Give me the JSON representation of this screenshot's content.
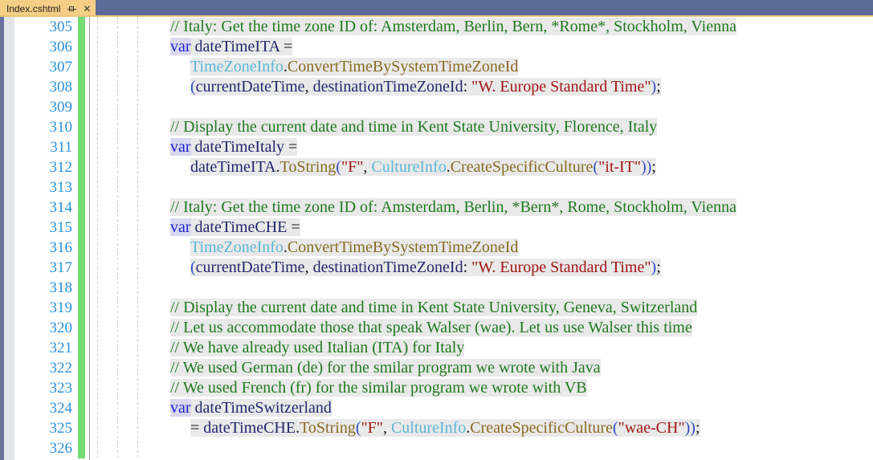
{
  "window": {
    "background_color": "#5c6a97",
    "accent_underline_color": "#e8c477"
  },
  "tab": {
    "label": "Index.cshtml",
    "pin_icon": "pin-icon",
    "close_icon": "close-icon",
    "close_glyph": "✕",
    "active": true,
    "background_color": "#f5cf85"
  },
  "editor": {
    "language": "csharp",
    "font": "serif",
    "line_number_color": "#2b91d8",
    "change_bar_color": "#73dd73",
    "first_line": 305,
    "last_line": 326,
    "indent_guides": 3,
    "colors": {
      "comment": "#1f7a1f",
      "keyword": "#2020cf",
      "identifier": "#22276e",
      "type": "#5bb7d6",
      "method": "#8a6b22",
      "string": "#a31515",
      "paren": "#2f4fc4",
      "highlight_band": "#e9e9e9"
    },
    "lines": [
      {
        "number": "305",
        "indent": 0,
        "tokens": [
          {
            "t": "// Italy: Get the time zone ID of: Amsterdam, Berlin, Bern, *Rome*, Stockholm, Vienna",
            "c": "t-comment"
          }
        ]
      },
      {
        "number": "306",
        "indent": 0,
        "tokens": [
          {
            "t": "var",
            "c": "t-keyword kw-bg"
          },
          {
            "t": " dateTimeITA ",
            "c": "t-ident"
          },
          {
            "t": "=",
            "c": "t-op"
          }
        ]
      },
      {
        "number": "307",
        "indent": 1,
        "tokens": [
          {
            "t": "TimeZoneInfo",
            "c": "t-type"
          },
          {
            "t": ".",
            "c": "t-punct"
          },
          {
            "t": "ConvertTimeBySystemTimeZoneId",
            "c": "t-method"
          }
        ]
      },
      {
        "number": "308",
        "indent": 1,
        "tokens": [
          {
            "t": "(",
            "c": "t-paren"
          },
          {
            "t": "currentDateTime",
            "c": "t-param"
          },
          {
            "t": ", ",
            "c": "t-punct"
          },
          {
            "t": "destinationTimeZoneId",
            "c": "t-param"
          },
          {
            "t": ": ",
            "c": "t-punct"
          },
          {
            "t": "\"W. Europe Standard Time\"",
            "c": "t-string"
          },
          {
            "t": ")",
            "c": "t-paren"
          },
          {
            "t": ";",
            "c": "t-punct"
          }
        ]
      },
      {
        "number": "309",
        "indent": 0,
        "tokens": []
      },
      {
        "number": "310",
        "indent": 0,
        "tokens": [
          {
            "t": "// Display the current date and time in Kent State University, Florence, Italy",
            "c": "t-comment"
          }
        ]
      },
      {
        "number": "311",
        "indent": 0,
        "tokens": [
          {
            "t": "var",
            "c": "t-keyword kw-bg"
          },
          {
            "t": " dateTimeItaly ",
            "c": "t-ident"
          },
          {
            "t": "=",
            "c": "t-op"
          }
        ]
      },
      {
        "number": "312",
        "indent": 1,
        "tokens": [
          {
            "t": "dateTimeITA",
            "c": "t-ident"
          },
          {
            "t": ".",
            "c": "t-punct"
          },
          {
            "t": "ToString",
            "c": "t-method"
          },
          {
            "t": "(",
            "c": "t-paren"
          },
          {
            "t": "\"F\"",
            "c": "t-string"
          },
          {
            "t": ", ",
            "c": "t-punct"
          },
          {
            "t": "CultureInfo",
            "c": "t-type"
          },
          {
            "t": ".",
            "c": "t-punct"
          },
          {
            "t": "CreateSpecificCulture",
            "c": "t-method"
          },
          {
            "t": "(",
            "c": "t-paren"
          },
          {
            "t": "\"it-IT\"",
            "c": "t-string"
          },
          {
            "t": "))",
            "c": "t-paren"
          },
          {
            "t": ";",
            "c": "t-punct"
          }
        ]
      },
      {
        "number": "313",
        "indent": 0,
        "tokens": []
      },
      {
        "number": "314",
        "indent": 0,
        "tokens": [
          {
            "t": "// Italy: Get the time zone ID of: Amsterdam, Berlin, *Bern*, Rome, Stockholm, Vienna",
            "c": "t-comment"
          }
        ]
      },
      {
        "number": "315",
        "indent": 0,
        "tokens": [
          {
            "t": "var",
            "c": "t-keyword kw-bg"
          },
          {
            "t": " dateTimeCHE ",
            "c": "t-ident"
          },
          {
            "t": "=",
            "c": "t-op"
          }
        ]
      },
      {
        "number": "316",
        "indent": 1,
        "tokens": [
          {
            "t": "TimeZoneInfo",
            "c": "t-type"
          },
          {
            "t": ".",
            "c": "t-punct"
          },
          {
            "t": "ConvertTimeBySystemTimeZoneId",
            "c": "t-method"
          }
        ]
      },
      {
        "number": "317",
        "indent": 1,
        "tokens": [
          {
            "t": "(",
            "c": "t-paren"
          },
          {
            "t": "currentDateTime",
            "c": "t-param"
          },
          {
            "t": ", ",
            "c": "t-punct"
          },
          {
            "t": "destinationTimeZoneId",
            "c": "t-param"
          },
          {
            "t": ": ",
            "c": "t-punct"
          },
          {
            "t": "\"W. Europe Standard Time\"",
            "c": "t-string"
          },
          {
            "t": ")",
            "c": "t-paren"
          },
          {
            "t": ";",
            "c": "t-punct"
          }
        ]
      },
      {
        "number": "318",
        "indent": 0,
        "tokens": []
      },
      {
        "number": "319",
        "indent": 0,
        "tokens": [
          {
            "t": "// Display the current date and time in Kent State University, Geneva, Switzerland",
            "c": "t-comment"
          }
        ]
      },
      {
        "number": "320",
        "indent": 0,
        "tokens": [
          {
            "t": "// Let us accommodate those that speak Walser (wae). Let us use Walser this time",
            "c": "t-comment"
          }
        ]
      },
      {
        "number": "321",
        "indent": 0,
        "tokens": [
          {
            "t": "// We have already used Italian (ITA) for Italy",
            "c": "t-comment"
          }
        ]
      },
      {
        "number": "322",
        "indent": 0,
        "tokens": [
          {
            "t": "// We used German (de) for the smilar program we wrote with Java",
            "c": "t-comment"
          }
        ]
      },
      {
        "number": "323",
        "indent": 0,
        "tokens": [
          {
            "t": "// We used French (fr) for the similar program we wrote with VB",
            "c": "t-comment"
          }
        ]
      },
      {
        "number": "324",
        "indent": 0,
        "tokens": [
          {
            "t": "var",
            "c": "t-keyword kw-bg"
          },
          {
            "t": " dateTimeSwitzerland",
            "c": "t-ident"
          }
        ]
      },
      {
        "number": "325",
        "indent": 1,
        "tokens": [
          {
            "t": "= ",
            "c": "t-op"
          },
          {
            "t": "dateTimeCHE",
            "c": "t-ident"
          },
          {
            "t": ".",
            "c": "t-punct"
          },
          {
            "t": "ToString",
            "c": "t-method"
          },
          {
            "t": "(",
            "c": "t-paren"
          },
          {
            "t": "\"F\"",
            "c": "t-string"
          },
          {
            "t": ", ",
            "c": "t-punct"
          },
          {
            "t": "CultureInfo",
            "c": "t-type"
          },
          {
            "t": ".",
            "c": "t-punct"
          },
          {
            "t": "CreateSpecificCulture",
            "c": "t-method"
          },
          {
            "t": "(",
            "c": "t-paren"
          },
          {
            "t": "\"wae-CH\"",
            "c": "t-string"
          },
          {
            "t": "))",
            "c": "t-paren"
          },
          {
            "t": ";",
            "c": "t-punct"
          }
        ]
      },
      {
        "number": "326",
        "indent": 0,
        "tokens": []
      }
    ]
  }
}
